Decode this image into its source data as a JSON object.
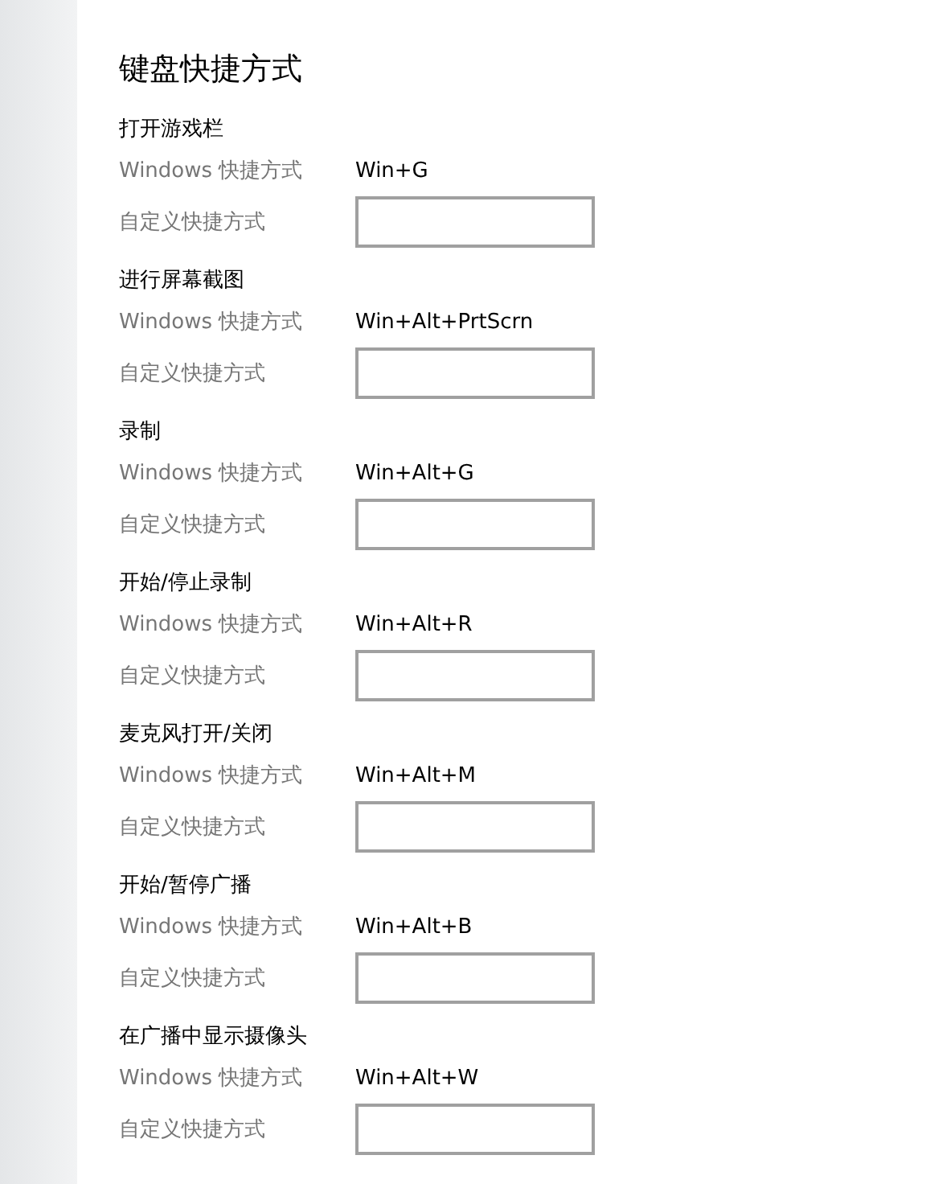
{
  "title": "键盘快捷方式",
  "sections": [
    {
      "heading": "打开游戏栏",
      "windows_label": "Windows 快捷方式",
      "shortcut": "Win+G",
      "custom_label": "自定义快捷方式"
    },
    {
      "heading": "进行屏幕截图",
      "windows_label": "Windows 快捷方式",
      "shortcut": "Win+Alt+PrtScrn",
      "custom_label": "自定义快捷方式"
    },
    {
      "heading": "录制",
      "windows_label": "Windows 快捷方式",
      "shortcut": "Win+Alt+G",
      "custom_label": "自定义快捷方式"
    },
    {
      "heading": "开始/停止录制",
      "windows_label": "Windows 快捷方式",
      "shortcut": "Win+Alt+R",
      "custom_label": "自定义快捷方式"
    },
    {
      "heading": "麦克风打开/关闭",
      "windows_label": "Windows 快捷方式",
      "shortcut": "Win+Alt+M",
      "custom_label": "自定义快捷方式"
    },
    {
      "heading": "开始/暂停广播",
      "windows_label": "Windows 快捷方式",
      "shortcut": "Win+Alt+B",
      "custom_label": "自定义快捷方式"
    },
    {
      "heading": "在广播中显示摄像头",
      "windows_label": "Windows 快捷方式",
      "shortcut": "Win+Alt+W",
      "custom_label": "自定义快捷方式"
    }
  ]
}
